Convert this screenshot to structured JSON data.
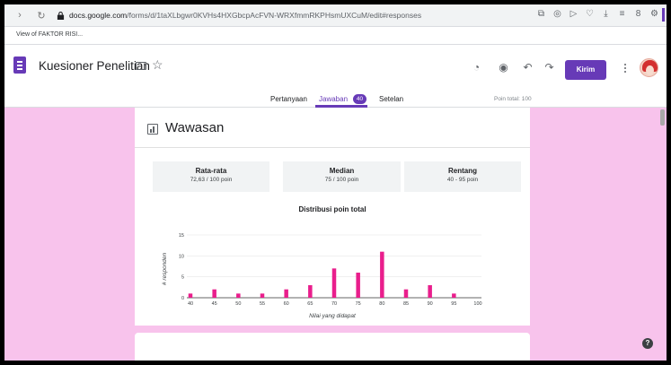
{
  "browser": {
    "url_host": "docs.google.com",
    "url_path": "/forms/d/1taXLbgwr0KVHs4HXGbcpAcFVN-WRXfmmRKPHsmUXCuM/edit#responses",
    "bookmark": "View of FAKTOR RISI..."
  },
  "form": {
    "title": "Kuesioner Penelitian",
    "send_label": "Kirim",
    "accent_color": "#673ab7",
    "background_color": "#f8c3ec",
    "tabs": [
      {
        "label": "Pertanyaan"
      },
      {
        "label": "Jawaban",
        "badge": "40"
      },
      {
        "label": "Setelan"
      }
    ],
    "points_total": "Poin total: 100"
  },
  "section": {
    "title": "Wawasan",
    "stats": [
      {
        "label": "Rata-rata",
        "value": "72,63 / 100 poin"
      },
      {
        "label": "Median",
        "value": "75 / 100 poin"
      },
      {
        "label": "Rentang",
        "value": "40 - 95 poin"
      }
    ]
  },
  "chart_data": {
    "type": "bar",
    "title": "Distribusi poin total",
    "xlabel": "Nilai yang didapat",
    "ylabel": "# responden",
    "x": [
      40,
      45,
      50,
      55,
      60,
      65,
      70,
      75,
      80,
      85,
      90,
      95,
      100
    ],
    "values": [
      1,
      2,
      1,
      1,
      2,
      3,
      7,
      6,
      11,
      2,
      3,
      1,
      0
    ],
    "yticks": [
      0,
      5,
      10,
      15
    ],
    "ylim": [
      0,
      15
    ],
    "bar_color": "#e91e8c",
    "grid": true
  }
}
